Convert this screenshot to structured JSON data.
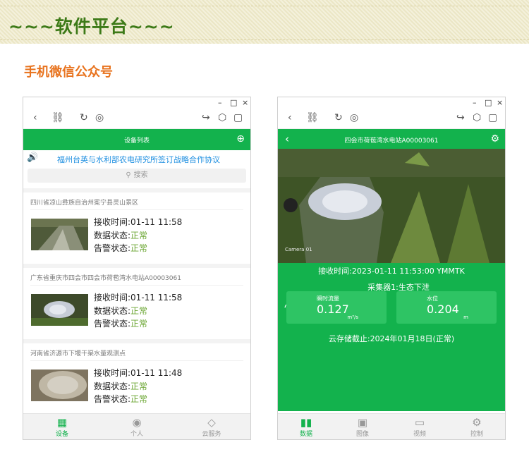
{
  "banner": {
    "title": "~~~软件平台~~~"
  },
  "section": {
    "title": "手机微信公众号"
  },
  "window": {
    "minimize": "–",
    "maximize": "□",
    "close": "×"
  },
  "phone1": {
    "header_title": "设备列表",
    "notice": "福州台英与水利部农电研究所签订战略合作协议",
    "search_placeholder": "搜索",
    "devices": [
      {
        "location": "四川省凉山彝族自治州冕宁县灵山景区",
        "receive": "接收时间:01-11 11:58",
        "data_status_label": "数据状态:",
        "data_status": "正常",
        "alarm_status_label": "告警状态:",
        "alarm_status": "正常"
      },
      {
        "location": "广东省重庆市四会市四会市荷苞湾水电站A00003061",
        "receive": "接收时间:01-11 11:58",
        "data_status_label": "数据状态:",
        "data_status": "正常",
        "alarm_status_label": "告警状态:",
        "alarm_status": "正常"
      },
      {
        "location": "河南省济源市下堰干渠水量观测点",
        "receive": "接收时间:01-11 11:48",
        "data_status_label": "数据状态:",
        "data_status": "正常",
        "alarm_status_label": "告警状态:",
        "alarm_status": "正常"
      }
    ],
    "tabs": [
      {
        "label": "设备",
        "icon": "grid-icon",
        "active": true
      },
      {
        "label": "个人",
        "icon": "person-icon",
        "active": false
      },
      {
        "label": "云服务",
        "icon": "tag-icon",
        "active": false
      }
    ]
  },
  "phone2": {
    "header_title": "四会市荷苞湾水电站A00003061",
    "camera_label": "Camera 01",
    "receive_time": "接收时间:2023-01-11 11:53:00 YMMTK",
    "collector": "采集器1:生态下泄",
    "flow": {
      "label": "瞬时流量",
      "value": "0.127",
      "unit": "m³/s"
    },
    "level": {
      "label": "水位",
      "value": "0.204",
      "unit": "m"
    },
    "cloud_storage": "云存储截止:2024年01月18日(正常)",
    "tabs": [
      {
        "label": "数据",
        "icon": "bar-chart-icon",
        "active": true
      },
      {
        "label": "图像",
        "icon": "image-icon",
        "active": false
      },
      {
        "label": "视频",
        "icon": "monitor-icon",
        "active": false
      },
      {
        "label": "控制",
        "icon": "gear-icon",
        "active": false
      }
    ]
  },
  "colors": {
    "brand_green": "#13b24d",
    "status_green": "#6aa531",
    "notice_blue": "#1e8fe0",
    "section_orange": "#e8731e",
    "banner_green": "#3d7a18"
  }
}
